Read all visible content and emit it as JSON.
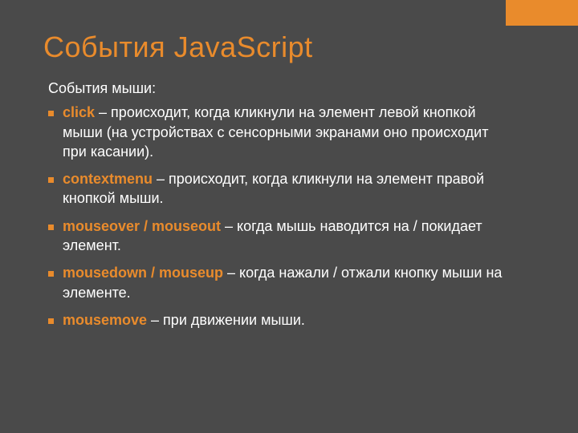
{
  "colors": {
    "accent": "#e98b2c",
    "background": "#4a4a4a",
    "text": "#ffffff"
  },
  "title": "События JavaScript",
  "intro": "События мыши:",
  "items": [
    {
      "event": "click",
      "desc": " – происходит, когда кликнули на элемент левой кнопкой мыши (на устройствах с сенсорными экранами оно происходит при касании)."
    },
    {
      "event": "contextmenu",
      "desc": " – происходит, когда кликнули на элемент правой кнопкой мыши."
    },
    {
      "event": "mouseover / mouseout",
      "desc": " – когда мышь наводится на / покидает элемент."
    },
    {
      "event": "mousedown / mouseup",
      "desc": " – когда нажали / отжали кнопку мыши на элементе."
    },
    {
      "event": "mousemove",
      "desc": " – при движении мыши."
    }
  ]
}
